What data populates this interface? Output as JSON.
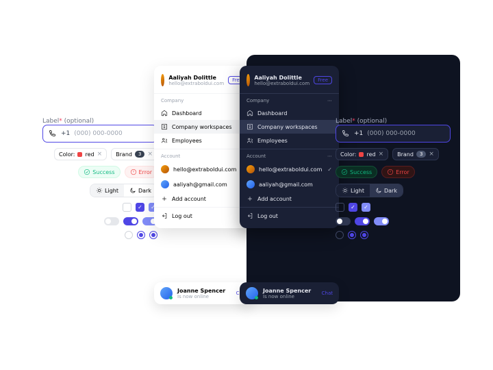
{
  "input": {
    "label": "Label",
    "required_mark": "*",
    "optional": "(optional)",
    "prefix": "+1",
    "placeholder": "(000) 000-0000"
  },
  "chips": {
    "color": {
      "key": "Color:",
      "value": "red"
    },
    "brand": {
      "label": "Brand",
      "count": "3"
    }
  },
  "status": {
    "success": "Success",
    "error": "Error"
  },
  "theme": {
    "light": "Light",
    "dark": "Dark"
  },
  "menu": {
    "user": {
      "name": "Aaliyah Dolittle",
      "email": "hello@extraboldui.com"
    },
    "badge": "Free",
    "sections": {
      "company": "Company",
      "account": "Account"
    },
    "items": {
      "dashboard": "Dashboard",
      "workspaces": "Company workspaces",
      "employees": "Employees",
      "add_account": "Add account",
      "logout": "Log out"
    },
    "accounts": [
      "hello@extraboldui.com",
      "aaliyah@gmail.com"
    ]
  },
  "toast": {
    "name": "Joanne Spencer",
    "status": "Is now online",
    "action": "Chat"
  }
}
